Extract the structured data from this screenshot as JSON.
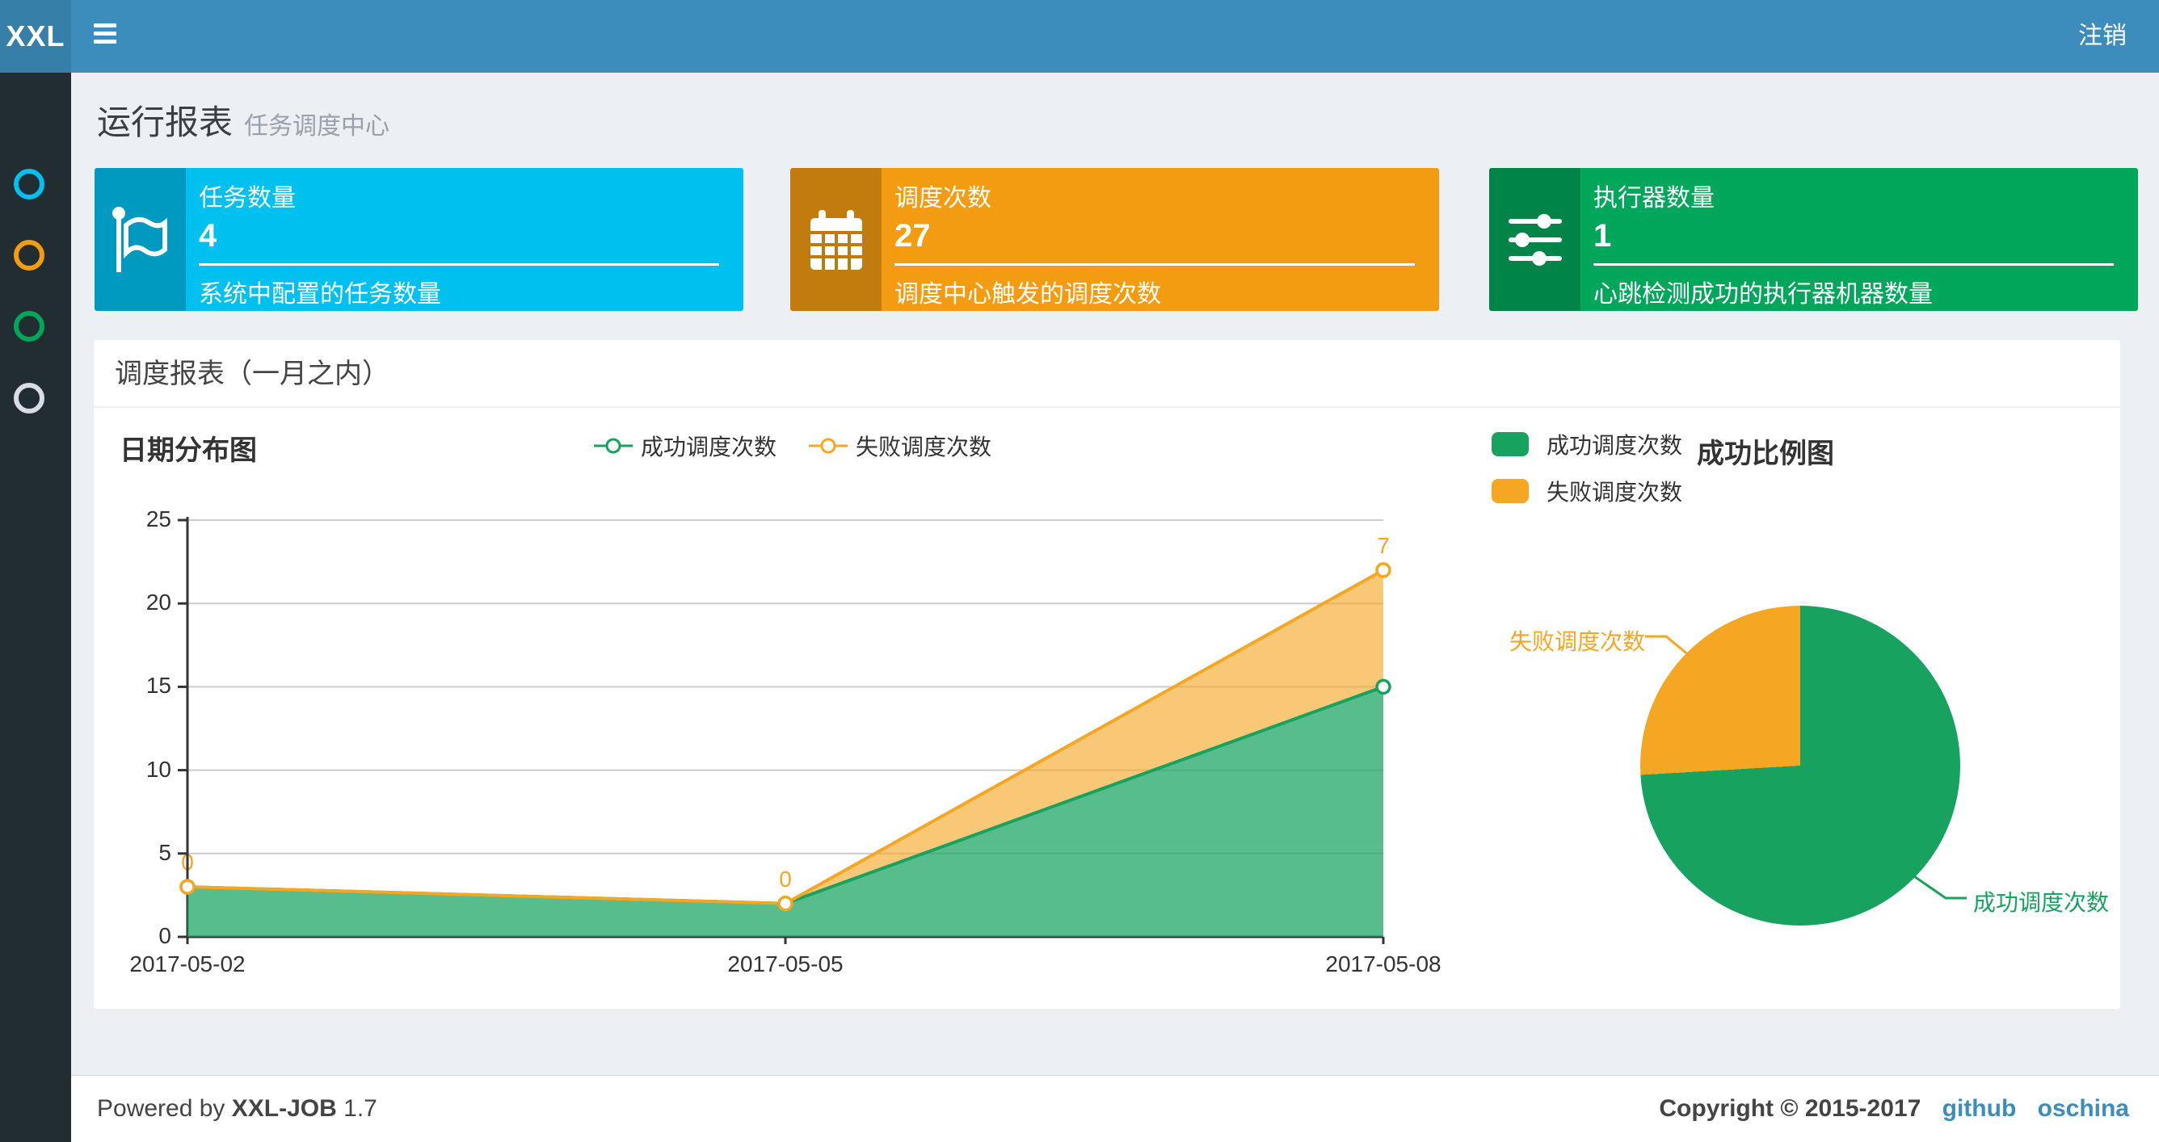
{
  "navbar": {
    "logo": "XXL",
    "logout": "注销"
  },
  "sidebar": {
    "items": [
      {
        "icon": "circle-icon",
        "color": "#00c0ef"
      },
      {
        "icon": "circle-icon",
        "color": "#f39c12"
      },
      {
        "icon": "circle-icon",
        "color": "#00a65a"
      },
      {
        "icon": "circle-icon",
        "color": "#d8dde3"
      }
    ]
  },
  "page_header": {
    "title": "运行报表",
    "subtitle": "任务调度中心"
  },
  "stat_cards": [
    {
      "label": "任务数量",
      "value": "4",
      "description": "系统中配置的任务数量",
      "color": "#00c0ef",
      "icon": "flag-icon"
    },
    {
      "label": "调度次数",
      "value": "27",
      "description": "调度中心触发的调度次数",
      "color": "#f39c12",
      "icon": "calendar-icon"
    },
    {
      "label": "执行器数量",
      "value": "1",
      "description": "心跳检测成功的执行器机器数量",
      "color": "#00a65a",
      "icon": "sliders-icon"
    }
  ],
  "panel": {
    "title": "调度报表（一月之内）"
  },
  "chart_data": [
    {
      "type": "area",
      "title": "日期分布图",
      "x": [
        "2017-05-02",
        "2017-05-05",
        "2017-05-08"
      ],
      "series": [
        {
          "name": "成功调度次数",
          "values": [
            3,
            2,
            15
          ],
          "color": "#17a35f"
        },
        {
          "name": "失败调度次数",
          "values": [
            0,
            0,
            7
          ],
          "color": "#f5a623"
        }
      ],
      "stacked": true,
      "point_labels_series": "失败调度次数",
      "point_labels": [
        "0",
        "0",
        "7"
      ],
      "ylim": [
        0,
        25
      ],
      "yticks": [
        0,
        5,
        10,
        15,
        20,
        25
      ],
      "grid": true,
      "legend_position": "top-center"
    },
    {
      "type": "pie",
      "title": "成功比例图",
      "slices": [
        {
          "label": "成功调度次数",
          "value": 20,
          "color": "#17a35f"
        },
        {
          "label": "失败调度次数",
          "value": 7,
          "color": "#f5a623"
        }
      ],
      "legend_position": "top-left"
    }
  ],
  "footer": {
    "powered_prefix": "Powered by",
    "product": "XXL-JOB",
    "version": "1.7",
    "copyright": "Copyright © 2015-2017",
    "links": [
      "github",
      "oschina"
    ]
  }
}
